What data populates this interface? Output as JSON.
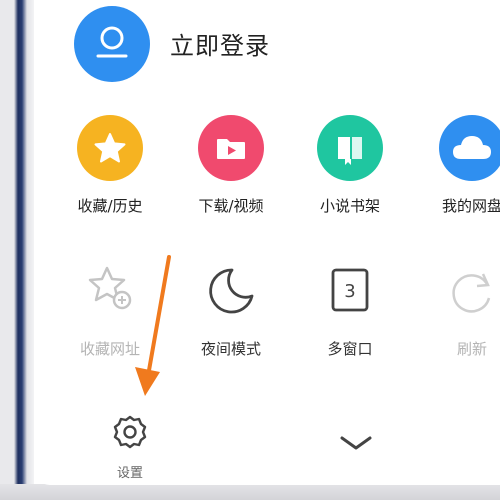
{
  "header": {
    "login_label": "立即登录",
    "avatar_icon": "user-avatar-icon"
  },
  "row1": [
    {
      "label": "收藏/历史",
      "icon": "star-icon",
      "color": "#f6b321"
    },
    {
      "label": "下载/视频",
      "icon": "video-folder-icon",
      "color": "#f04a6e"
    },
    {
      "label": "小说书架",
      "icon": "book-icon",
      "color": "#1fc6a0"
    },
    {
      "label": "我的网盘",
      "icon": "cloud-icon",
      "color": "#2f8ff0"
    }
  ],
  "row2": [
    {
      "label": "收藏网址",
      "icon": "star-add-icon"
    },
    {
      "label": "夜间模式",
      "icon": "moon-icon"
    },
    {
      "label": "多窗口",
      "icon": "window-count-icon",
      "count": "3"
    },
    {
      "label": "刷新",
      "icon": "refresh-icon"
    }
  ],
  "footer": {
    "settings_label": "设置",
    "settings_icon": "gear-icon",
    "collapse_icon": "chevron-down-icon"
  },
  "annotation": {
    "arrow_color": "#f07a1e"
  }
}
